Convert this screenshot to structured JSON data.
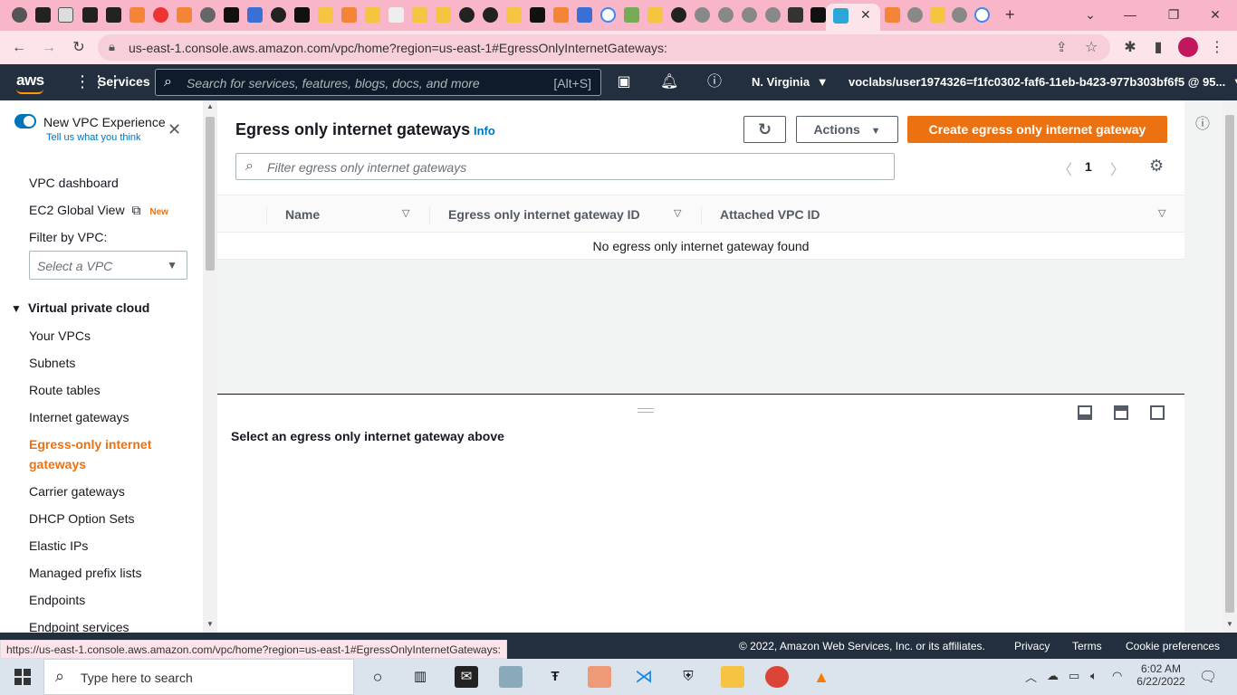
{
  "browser": {
    "url": "us-east-1.console.aws.amazon.com/vpc/home?region=us-east-1#EgressOnlyInternetGateways:",
    "status_url": "https://us-east-1.console.aws.amazon.com/vpc/home?region=us-east-1#EgressOnlyInternetGateways:"
  },
  "aws_header": {
    "logo": "aws",
    "services_label": "Services",
    "search_placeholder": "Search for services, features, blogs, docs, and more",
    "search_shortcut": "[Alt+S]",
    "region": "N. Virginia",
    "account": "voclabs/user1974326=f1fc0302-faf6-11eb-b423-977b303bf6f5 @ 95..."
  },
  "sidebar": {
    "new_experience_label": "New VPC Experience",
    "feedback_link": "Tell us what you think",
    "vpc_dashboard": "VPC dashboard",
    "ec2_global_view": "EC2 Global View",
    "new_badge": "New",
    "filter_label": "Filter by VPC:",
    "filter_placeholder": "Select a VPC",
    "section_title": "Virtual private cloud",
    "items": [
      "Your VPCs",
      "Subnets",
      "Route tables",
      "Internet gateways",
      "Egress-only internet gateways",
      "Carrier gateways",
      "DHCP Option Sets",
      "Elastic IPs",
      "Managed prefix lists",
      "Endpoints",
      "Endpoint services"
    ]
  },
  "main": {
    "title": "Egress only internet gateways",
    "info_link": "Info",
    "actions_label": "Actions",
    "create_label": "Create egress only internet gateway",
    "filter_placeholder": "Filter egress only internet gateways",
    "page_number": "1",
    "columns": [
      "Name",
      "Egress only internet gateway ID",
      "Attached VPC ID"
    ],
    "empty_message": "No egress only internet gateway found",
    "detail_message": "Select an egress only internet gateway above"
  },
  "footer": {
    "copyright": "© 2022, Amazon Web Services, Inc. or its affiliates.",
    "privacy": "Privacy",
    "terms": "Terms",
    "cookies": "Cookie preferences"
  },
  "taskbar": {
    "search_placeholder": "Type here to search",
    "time": "6:02 AM",
    "date": "6/22/2022"
  },
  "colors": {
    "aws_header": "#232f3e",
    "accent_orange": "#ec7211",
    "link_blue": "#0073bb",
    "tab_strip": "#f9b6c8"
  }
}
